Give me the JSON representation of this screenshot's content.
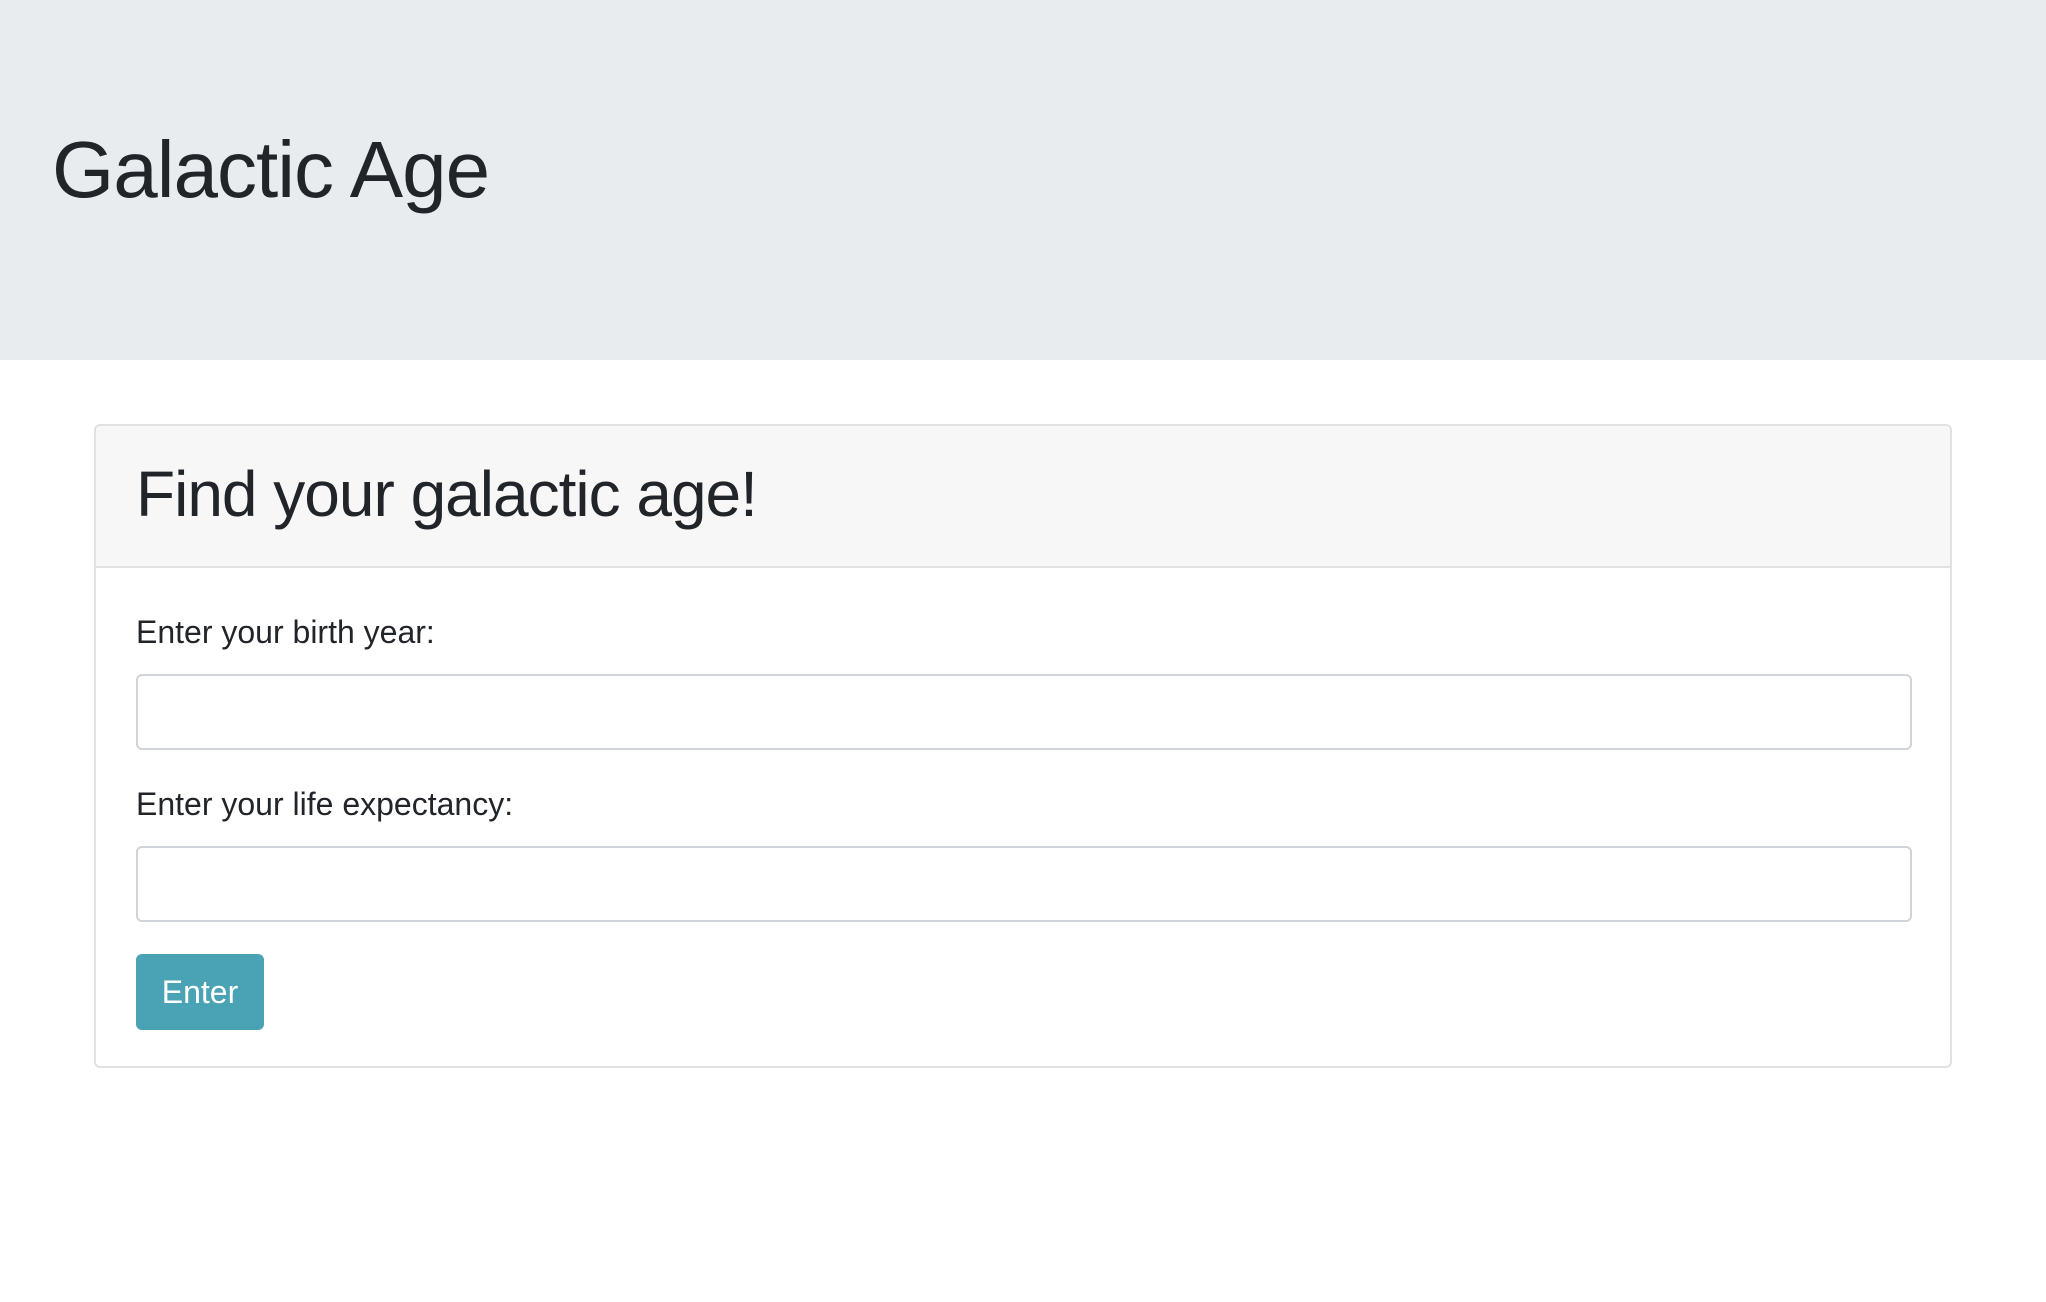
{
  "header": {
    "title": "Galactic Age"
  },
  "card": {
    "title": "Find your galactic age!",
    "birth_year": {
      "label": "Enter your birth year:",
      "value": "",
      "placeholder": ""
    },
    "life_expectancy": {
      "label": "Enter your life expectancy:",
      "value": "",
      "placeholder": ""
    },
    "submit_label": "Enter"
  },
  "colors": {
    "header_background": "#e9ecef",
    "card_header_background": "#f7f7f7",
    "button_accent": "#4aa3b5",
    "text": "#212529"
  }
}
